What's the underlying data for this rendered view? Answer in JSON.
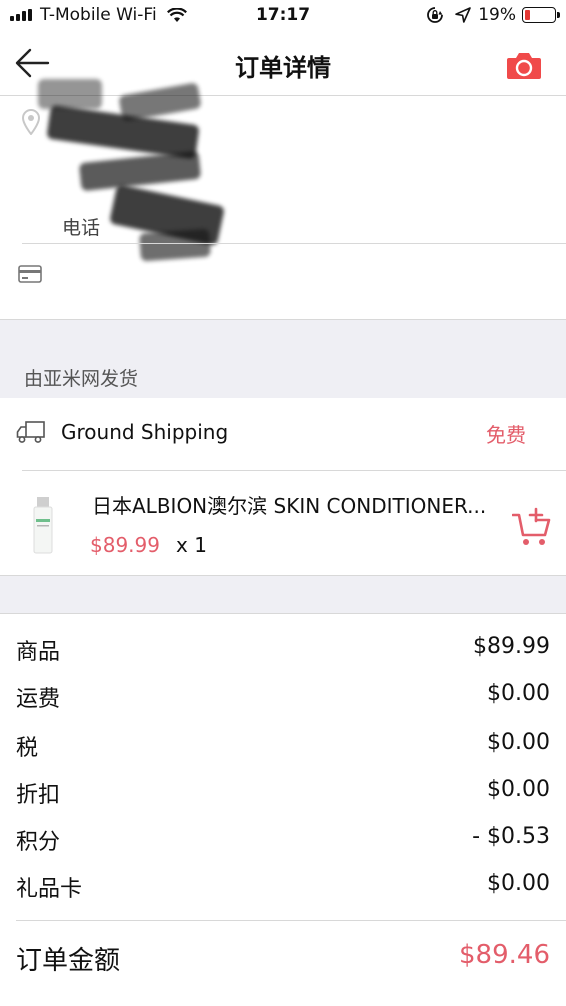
{
  "status_bar": {
    "carrier": "T-Mobile Wi-Fi",
    "time": "17:17",
    "battery_percent": "19%",
    "battery_level": 0.19,
    "icons": [
      "signal-icon",
      "wifi-icon",
      "orientation-lock-icon",
      "location-arrow-icon",
      "battery-icon"
    ]
  },
  "nav": {
    "title": "订单详情",
    "back_icon": "arrow-left-icon",
    "camera_icon": "camera-icon"
  },
  "address": {
    "phone_label": "电话"
  },
  "section": {
    "shipper": "由亚米网发货"
  },
  "shipping": {
    "method": "Ground Shipping",
    "fee": "免费"
  },
  "product": {
    "name": "日本ALBION澳尔滨 SKIN CONDITIONER...",
    "price": "$89.99",
    "quantity": "x 1"
  },
  "summary": [
    {
      "label": "商品",
      "value": "$89.99"
    },
    {
      "label": "运费",
      "value": "$0.00"
    },
    {
      "label": "税",
      "value": "$0.00"
    },
    {
      "label": "折扣",
      "value": "$0.00"
    },
    {
      "label": "积分",
      "value": "- $0.53"
    },
    {
      "label": "礼品卡",
      "value": "$0.00"
    }
  ],
  "total": {
    "label": "订单金额",
    "value": "$89.46"
  },
  "colors": {
    "accent_red": "#e35d6a",
    "camera_red": "#f04a4a",
    "background_gray": "#efeff4"
  }
}
